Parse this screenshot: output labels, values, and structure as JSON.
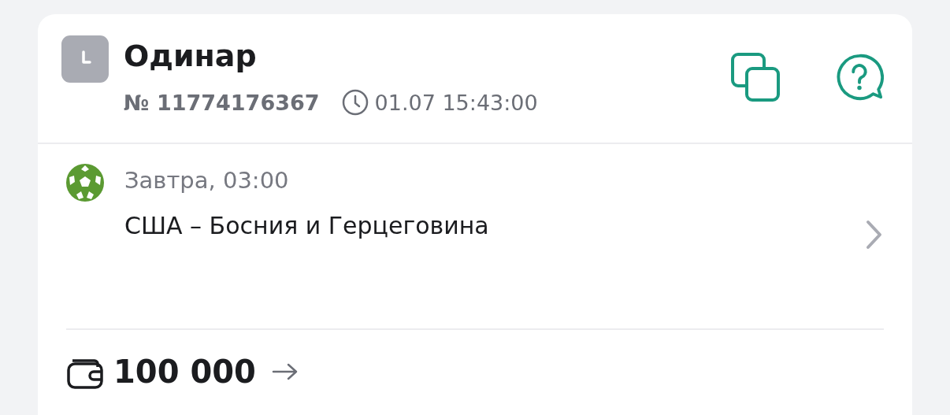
{
  "bet": {
    "title": "Одинар",
    "number": "№ 11774176367",
    "datetime": "01.07 15:43:00"
  },
  "event": {
    "time": "Завтра, 03:00",
    "teams": "США – Босния и Герцеговина"
  },
  "stake": {
    "amount": "100 000"
  }
}
